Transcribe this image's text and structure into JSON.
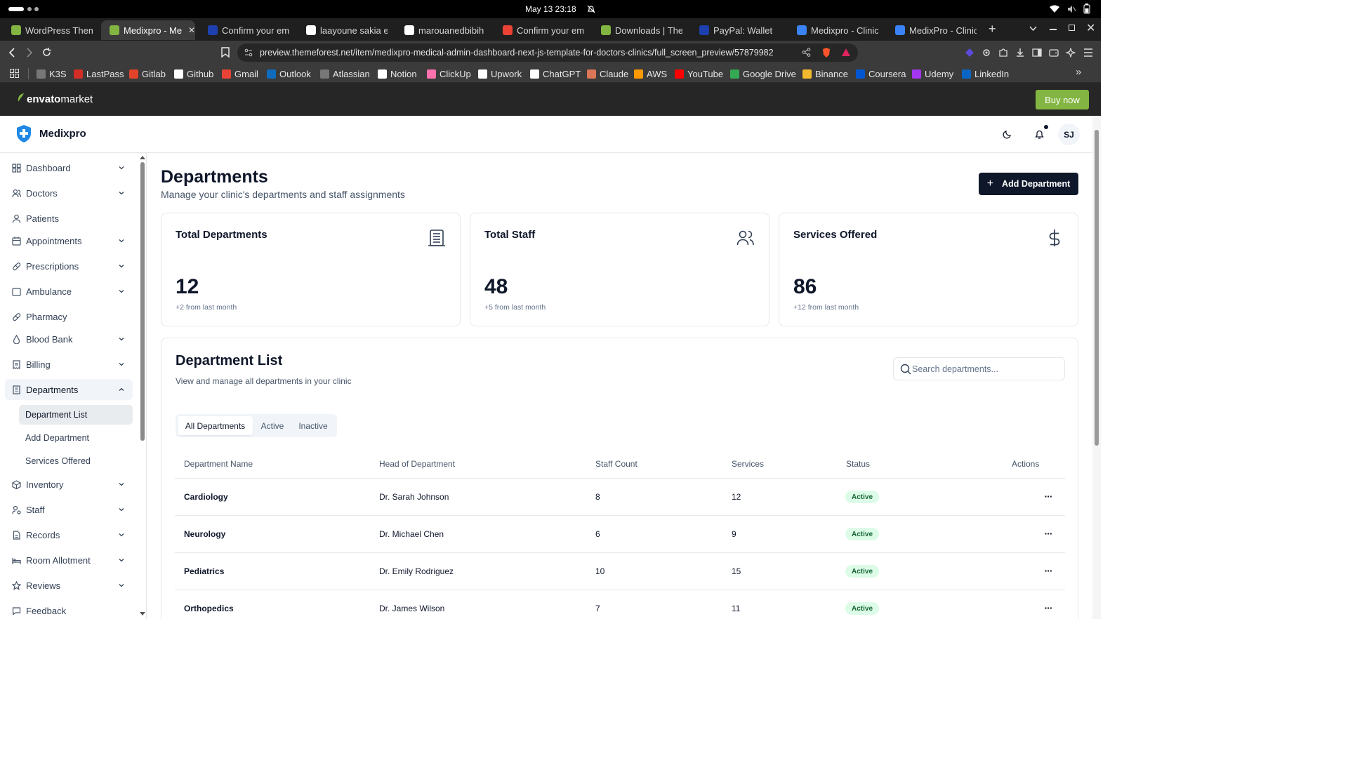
{
  "system": {
    "clock": "May 13  23:18"
  },
  "tabs": [
    {
      "label": "WordPress Theme",
      "fav_color": "#82b541",
      "active": false
    },
    {
      "label": "Medixpro - Me",
      "fav_color": "#82b541",
      "active": true
    },
    {
      "label": "Confirm your ema",
      "fav_color": "#1e40af",
      "active": false
    },
    {
      "label": "laayoune sakia el",
      "fav_color": "#ffffff",
      "active": false
    },
    {
      "label": "marouanedbibih",
      "fav_color": "#ffffff",
      "active": false
    },
    {
      "label": "Confirm your ema",
      "fav_color": "#ea4335",
      "active": false
    },
    {
      "label": "Downloads | Them",
      "fav_color": "#82b541",
      "active": false
    },
    {
      "label": "PayPal: Wallet",
      "fav_color": "#1e40af",
      "active": false
    },
    {
      "label": "Medixpro - Clinic",
      "fav_color": "#3b82f6",
      "active": false
    },
    {
      "label": "MedixPro - Clinic",
      "fav_color": "#3b82f6",
      "active": false
    }
  ],
  "address": {
    "url": "preview.themeforest.net/item/medixpro-medical-admin-dashboard-next-js-template-for-doctors-clinics/full_screen_preview/57879982"
  },
  "bookmarks": [
    {
      "label": "K3S",
      "color": "#777777"
    },
    {
      "label": "LastPass",
      "color": "#d32d27"
    },
    {
      "label": "Gitlab",
      "color": "#e24329"
    },
    {
      "label": "Github",
      "color": "#ffffff"
    },
    {
      "label": "Gmail",
      "color": "#ea4335"
    },
    {
      "label": "Outlook",
      "color": "#0f6cbd"
    },
    {
      "label": "Atlassian",
      "color": "#777777"
    },
    {
      "label": "Notion",
      "color": "#ffffff"
    },
    {
      "label": "ClickUp",
      "color": "#fd71af"
    },
    {
      "label": "Upwork",
      "color": "#ffffff"
    },
    {
      "label": "ChatGPT",
      "color": "#ffffff"
    },
    {
      "label": "Claude",
      "color": "#d97757"
    },
    {
      "label": "AWS",
      "color": "#ff9900"
    },
    {
      "label": "YouTube",
      "color": "#ff0000"
    },
    {
      "label": "Google Drive",
      "color": "#34a853"
    },
    {
      "label": "Binance",
      "color": "#f3ba2f"
    },
    {
      "label": "Coursera",
      "color": "#0056d2"
    },
    {
      "label": "Udemy",
      "color": "#a435f0"
    },
    {
      "label": "LinkedIn",
      "color": "#0a66c2"
    }
  ],
  "envato": {
    "logo": "envato",
    "logo_suffix": "market",
    "buy_label": "Buy now"
  },
  "app": {
    "name": "Medixpro",
    "avatar": "SJ",
    "brand_color": "#1e88e5"
  },
  "sidebar": {
    "items": [
      {
        "label": "Dashboard",
        "icon": "grid-icon"
      },
      {
        "label": "Doctors",
        "icon": "users-icon"
      },
      {
        "label": "Patients",
        "icon": "user-icon"
      },
      {
        "label": "Appointments",
        "icon": "calendar-icon"
      },
      {
        "label": "Prescriptions",
        "icon": "pill-icon"
      },
      {
        "label": "Ambulance",
        "icon": "ambulance-icon"
      },
      {
        "label": "Pharmacy",
        "icon": "pill-icon"
      },
      {
        "label": "Blood Bank",
        "icon": "droplet-icon"
      },
      {
        "label": "Billing",
        "icon": "receipt-icon"
      },
      {
        "label": "Departments",
        "icon": "building-icon"
      },
      {
        "label": "Inventory",
        "icon": "package-icon"
      },
      {
        "label": "Staff",
        "icon": "user-cog-icon"
      },
      {
        "label": "Records",
        "icon": "file-icon"
      },
      {
        "label": "Room Allotment",
        "icon": "bed-icon"
      },
      {
        "label": "Reviews",
        "icon": "star-icon"
      },
      {
        "label": "Feedback",
        "icon": "message-icon"
      }
    ],
    "sub_items": [
      "Department List",
      "Add Department",
      "Services Offered"
    ]
  },
  "page": {
    "title": "Departments",
    "subtitle": "Manage your clinic's departments and staff assignments",
    "add_button": "Add Department"
  },
  "stats": [
    {
      "title": "Total Departments",
      "value": "12",
      "delta": "+2 from last month",
      "icon": "building-icon"
    },
    {
      "title": "Total Staff",
      "value": "48",
      "delta": "+5 from last month",
      "icon": "users-icon"
    },
    {
      "title": "Services Offered",
      "value": "86",
      "delta": "+12 from last month",
      "icon": "dollar-icon"
    }
  ],
  "list": {
    "title": "Department List",
    "subtitle": "View and manage all departments in your clinic",
    "search_placeholder": "Search departments...",
    "filters": [
      "All Departments",
      "Active",
      "Inactive"
    ],
    "headers": [
      "Department Name",
      "Head of Department",
      "Staff Count",
      "Services",
      "Status",
      "Actions"
    ],
    "rows": [
      {
        "name": "Cardiology",
        "head": "Dr. Sarah Johnson",
        "staff": "8",
        "services": "12",
        "status": "Active"
      },
      {
        "name": "Neurology",
        "head": "Dr. Michael Chen",
        "staff": "6",
        "services": "9",
        "status": "Active"
      },
      {
        "name": "Pediatrics",
        "head": "Dr. Emily Rodriguez",
        "staff": "10",
        "services": "15",
        "status": "Active"
      },
      {
        "name": "Orthopedics",
        "head": "Dr. James Wilson",
        "staff": "7",
        "services": "11",
        "status": "Active"
      }
    ]
  }
}
